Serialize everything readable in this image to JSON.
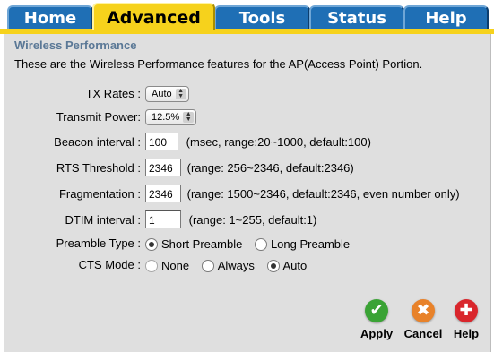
{
  "tabs": {
    "home": "Home",
    "advanced": "Advanced",
    "tools": "Tools",
    "status": "Status",
    "help": "Help"
  },
  "section": {
    "title": "Wireless Performance",
    "description": "These are the Wireless Performance features for the AP(Access Point) Portion."
  },
  "tx_rates": {
    "label": "TX Rates :",
    "value": "Auto"
  },
  "transmit_power": {
    "label": "Transmit Power:",
    "value": "12.5%"
  },
  "beacon_interval": {
    "label": "Beacon interval :",
    "value": "100",
    "hint": "(msec, range:20~1000, default:100)"
  },
  "rts_threshold": {
    "label": "RTS Threshold :",
    "value": "2346",
    "hint": "(range: 256~2346, default:2346)"
  },
  "fragmentation": {
    "label": "Fragmentation :",
    "value": "2346",
    "hint": "(range: 1500~2346, default:2346, even number only)"
  },
  "dtim_interval": {
    "label": "DTIM interval :",
    "value": "1",
    "hint": "(range: 1~255, default:1)"
  },
  "preamble": {
    "label": "Preamble Type :",
    "options": [
      "Short Preamble",
      "Long Preamble"
    ],
    "selected": "Short Preamble"
  },
  "cts_mode": {
    "label": "CTS Mode :",
    "options": [
      "None",
      "Always",
      "Auto"
    ],
    "selected": "Auto"
  },
  "actions": {
    "apply": "Apply",
    "cancel": "Cancel",
    "help": "Help"
  },
  "colors": {
    "tab_blue": "#1f6fb5",
    "tab_active": "#f6d21c",
    "panel": "#dfdfdf",
    "title": "#5a7896",
    "apply": "#3aa335",
    "cancel": "#e8822a",
    "help": "#d9262c"
  }
}
